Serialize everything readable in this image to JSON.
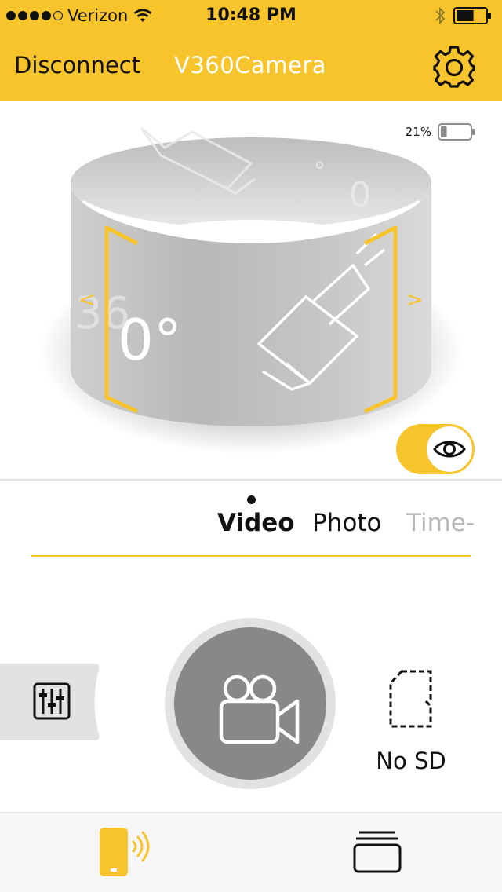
{
  "status_bar": {
    "carrier": "Verizon",
    "time": "10:48 PM",
    "signal_dots_filled": 4,
    "signal_dots_total": 5,
    "phone_battery_level": 0.6
  },
  "nav": {
    "disconnect_label": "Disconnect",
    "title": "V360Camera",
    "settings_icon": "gear-icon"
  },
  "preview": {
    "camera_battery_text": "21%",
    "camera_battery_level": 0.21,
    "view_toggle_on": true,
    "view_toggle_icon": "eye-icon"
  },
  "modes": {
    "items": [
      {
        "label": "Video",
        "active": true
      },
      {
        "label": "Photo",
        "active": false
      },
      {
        "label": "Time-",
        "active": false
      }
    ]
  },
  "controls": {
    "settings_icon": "sliders-icon",
    "record_icon": "video-camera-icon",
    "sd_icon": "sd-card-icon",
    "sd_status": "No SD"
  },
  "tabbar": {
    "items": [
      {
        "icon": "camera-connected-icon",
        "active": true
      },
      {
        "icon": "gallery-icon",
        "active": false
      }
    ]
  },
  "colors": {
    "accent": "#f7c42b",
    "record_button": "#888888",
    "record_ring": "#e1e2e4"
  }
}
